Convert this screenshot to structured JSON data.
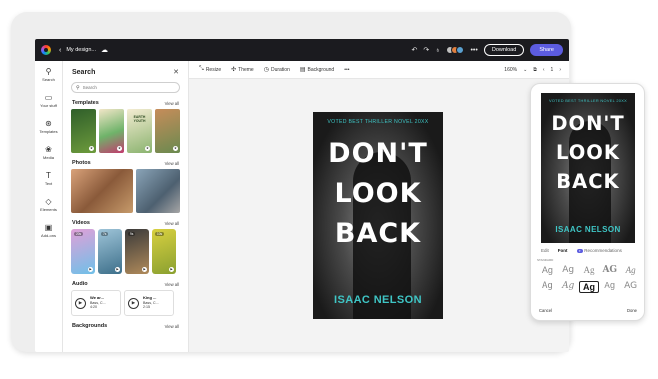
{
  "topbar": {
    "doc_name": "My design...",
    "download_label": "Download",
    "share_label": "Share"
  },
  "rail": [
    {
      "label": "Search",
      "icon": "search-icon"
    },
    {
      "label": "Your stuff",
      "icon": "folder-icon"
    },
    {
      "label": "Templates",
      "icon": "templates-icon"
    },
    {
      "label": "Media",
      "icon": "media-icon"
    },
    {
      "label": "Text",
      "icon": "text-icon"
    },
    {
      "label": "Elements",
      "icon": "elements-icon"
    },
    {
      "label": "Add-ons",
      "icon": "addons-icon"
    }
  ],
  "panel": {
    "title": "Search",
    "search_placeholder": "Search",
    "sections": {
      "templates": "Templates",
      "photos": "Photos",
      "videos": "Videos",
      "audio": "Audio",
      "backgrounds": "Backgrounds"
    },
    "view_all": "View all",
    "template_texts": [
      "",
      "",
      "EARTH YOUTH",
      ""
    ],
    "video_durations": [
      "20s",
      "7s",
      "9s",
      "10s"
    ],
    "audio": [
      {
        "title": "We ar...",
        "artist": "Bass, C...",
        "duration": "4:20"
      },
      {
        "title": "King ...",
        "artist": "Bass, C...",
        "duration": "2:15"
      }
    ]
  },
  "canvas_toolbar": {
    "items": [
      "Resize",
      "Theme",
      "Duration",
      "Background"
    ],
    "more": "•••",
    "zoom": "160%",
    "page": "1"
  },
  "cover": {
    "top_line": "VOTED BEST THRILLER NOVEL 20XX",
    "title_lines": [
      "DON'T",
      "LOOK",
      "BACK"
    ],
    "author": "ISAAC NELSON"
  },
  "phone": {
    "tabs": [
      "Edit",
      "Font"
    ],
    "recommend_label": "Recommendations",
    "standard_label": "STANDARD",
    "font_sample": "Ag",
    "cancel": "Cancel",
    "done": "Done"
  },
  "colors": {
    "accent": "#5c5ce0",
    "cover_teal": "#3fc6c6"
  }
}
